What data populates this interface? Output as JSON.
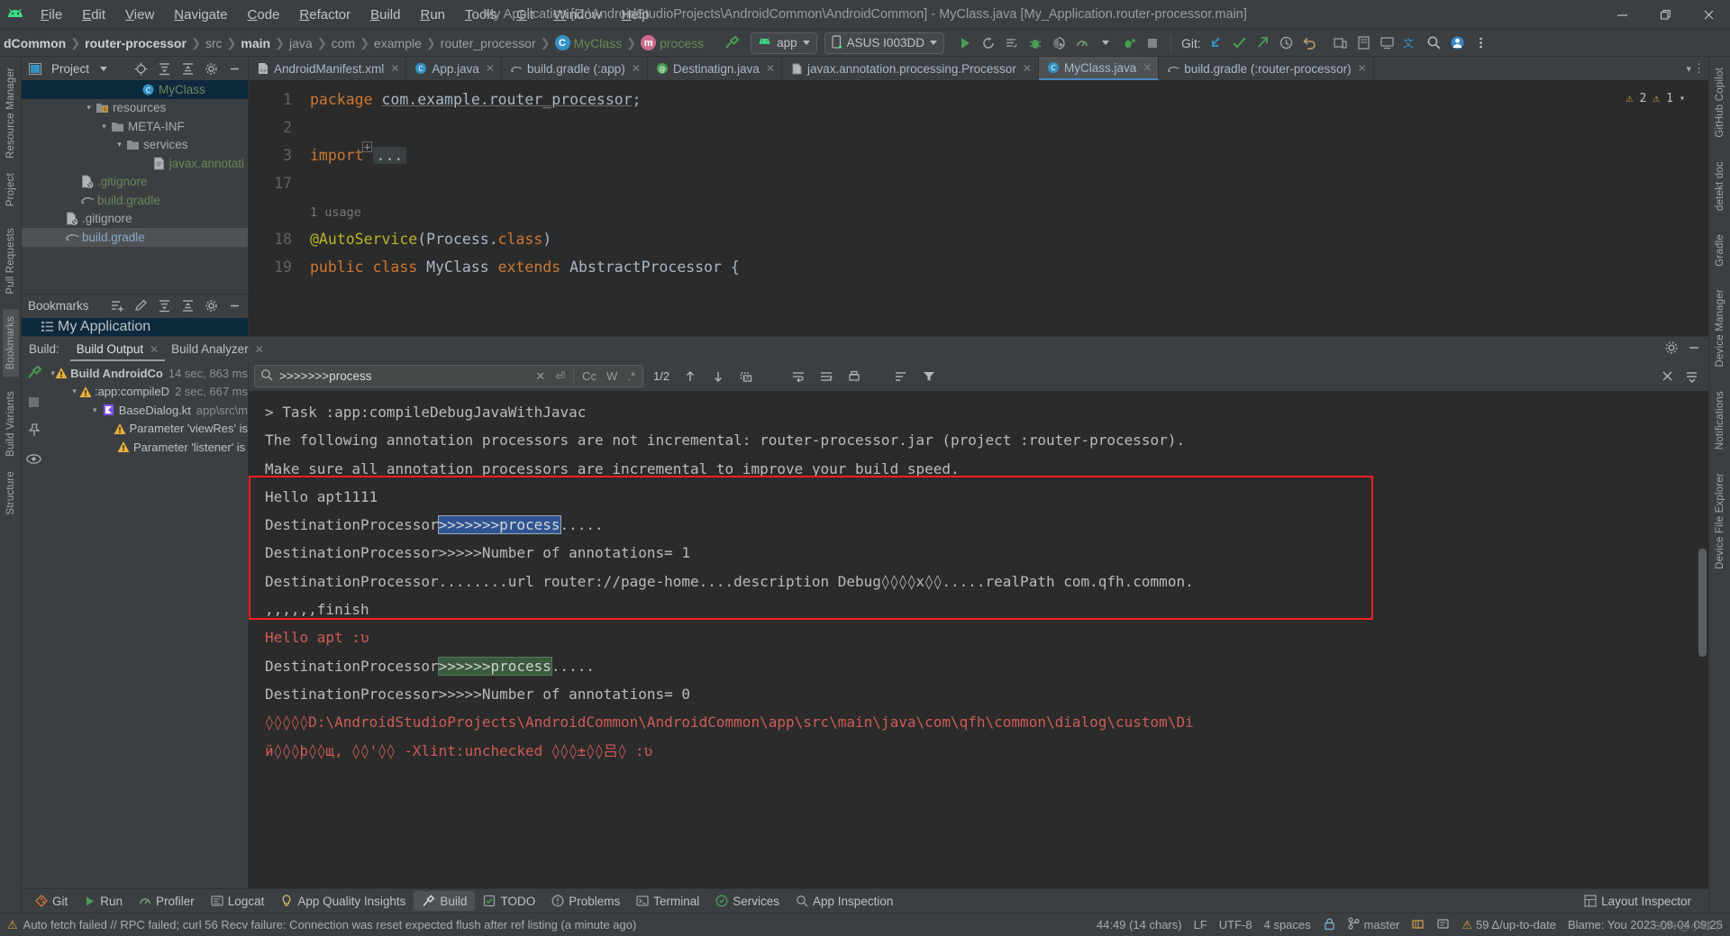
{
  "window": {
    "title": "My Application [D:\\AndroidStudioProjects\\AndroidCommon\\AndroidCommon] - MyClass.java [My_Application.router-processor.main]",
    "minimize": "—",
    "maximize": "❐",
    "close": "✕",
    "logo_icon": "android-logo"
  },
  "menu": [
    {
      "label": "File",
      "mnemonic": "F"
    },
    {
      "label": "Edit",
      "mnemonic": "E"
    },
    {
      "label": "View",
      "mnemonic": "V"
    },
    {
      "label": "Navigate",
      "mnemonic": "N"
    },
    {
      "label": "Code",
      "mnemonic": "C"
    },
    {
      "label": "Refactor",
      "mnemonic": "R"
    },
    {
      "label": "Build",
      "mnemonic": "B"
    },
    {
      "label": "Run",
      "mnemonic": "R"
    },
    {
      "label": "Tools",
      "mnemonic": "T"
    },
    {
      "label": "Git",
      "mnemonic": "G"
    },
    {
      "label": "Window",
      "mnemonic": "W"
    },
    {
      "label": "Help",
      "mnemonic": "H"
    }
  ],
  "breadcrumbs": [
    {
      "label": "dCommon",
      "style": "bold"
    },
    {
      "label": "router-processor",
      "style": "bold"
    },
    {
      "label": "src",
      "style": "dim"
    },
    {
      "label": "main",
      "style": "bold"
    },
    {
      "label": "java",
      "style": "dim"
    },
    {
      "label": "com",
      "style": "dim"
    },
    {
      "label": "example",
      "style": "dim"
    },
    {
      "label": "router_processor",
      "style": "dim"
    },
    {
      "label": "MyClass",
      "style": "class",
      "icon": "C"
    },
    {
      "label": "process",
      "style": "method",
      "icon": "m"
    }
  ],
  "toolbar": {
    "build_hammer_icon": "hammer-icon",
    "run_config": {
      "label": "app",
      "icon": "android-head-icon"
    },
    "device": {
      "label": "ASUS I003DD",
      "icon": "phone-icon"
    },
    "run_icon": "run-play-icon",
    "rerun_icon": "rerun-icon",
    "apply_changes_icon": "apply-changes-icon",
    "debug_icon": "debug-bug-icon",
    "coverage_icon": "coverage-icon",
    "profiler_icon": "profiler-icon",
    "attach_debugger_icon": "attach-debugger-icon",
    "stop_icon": "stop-square-icon",
    "git_label": "Git:",
    "git_update_icon": "update-project-icon",
    "git_commit_icon": "commit-icon",
    "git_push_icon": "push-icon",
    "history_icon": "history-icon",
    "undo_icon": "undo-icon",
    "device_manager_icon": "device-manager-icon",
    "device_explorer_icon": "device-explorer-icon",
    "avd_icon": "avd-icon",
    "translate_icon": "translate-icon",
    "search_icon": "search-everywhere-icon",
    "account_icon": "account-avatar-icon",
    "more_icon": "more-vertical-icon"
  },
  "project_panel": {
    "title": "Project",
    "dropdown_icon": "chevron-down-icon",
    "locate_icon": "locate-icon",
    "expand_icon": "expand-all-icon",
    "collapse_icon": "collapse-all-icon",
    "settings_icon": "gear-icon",
    "hide_icon": "hide-icon",
    "tree": [
      {
        "label": "MyClass",
        "indent": 7,
        "icon": "class-icon",
        "color": "green",
        "selected": true,
        "chevron": ""
      },
      {
        "label": "resources",
        "indent": 4,
        "icon": "resource-folder-icon",
        "color": "gray",
        "chevron": "v"
      },
      {
        "label": "META-INF",
        "indent": 5,
        "icon": "folder-icon",
        "color": "gray",
        "chevron": "v"
      },
      {
        "label": "services",
        "indent": 6,
        "icon": "folder-icon",
        "color": "gray",
        "chevron": "v"
      },
      {
        "label": "javax.annotati",
        "indent": 8,
        "icon": "file-icon",
        "color": "green",
        "chevron": ""
      },
      {
        "label": ".gitignore",
        "indent": 3,
        "icon": "gitignore-icon",
        "color": "green",
        "chevron": ""
      },
      {
        "label": "build.gradle",
        "indent": 3,
        "icon": "gradle-icon",
        "color": "green",
        "chevron": ""
      },
      {
        "label": ".gitignore",
        "indent": 2,
        "icon": "gitignore-icon",
        "color": "gray",
        "chevron": ""
      },
      {
        "label": "build.gradle",
        "indent": 2,
        "icon": "gradle-icon",
        "color": "blue",
        "chevron": "",
        "highlight": true
      }
    ]
  },
  "bookmarks_panel": {
    "title": "Bookmarks",
    "add_icon": "add-bookmark-icon",
    "edit_icon": "edit-pencil-icon",
    "expand_icon": "expand-all-icon",
    "collapse_icon": "collapse-all-icon",
    "settings_icon": "gear-icon",
    "hide_icon": "hide-icon",
    "items": [
      {
        "label": "My Application",
        "icon": "bookmark-list-icon",
        "selected": true
      }
    ]
  },
  "editor_tabs": [
    {
      "label": "AndroidManifest.xml",
      "icon": "xml-icon",
      "icon_color": "#d3783c",
      "active": false
    },
    {
      "label": "App.java",
      "icon": "C",
      "icon_color": "#3592c4",
      "active": false
    },
    {
      "label": "build.gradle (:app)",
      "icon": "gradle-icon",
      "icon_color": "#7a8c99",
      "active": false
    },
    {
      "label": "Destinatign.java",
      "icon": "A",
      "icon_color": "#499c54",
      "active": false
    },
    {
      "label": "javax.annotation.processing.Processor",
      "icon": "file-icon",
      "icon_color": "#9aa0a6",
      "active": false
    },
    {
      "label": "MyClass.java",
      "icon": "C",
      "icon_color": "#3592c4",
      "active": true
    },
    {
      "label": "build.gradle (:router-processor)",
      "icon": "gradle-icon",
      "icon_color": "#7a8c99",
      "active": false
    }
  ],
  "editor": {
    "inspection": {
      "warnings": "2",
      "weak_warnings": "1",
      "warn_icon": "warning-triangle-icon",
      "info_icon": "info-icon",
      "chevron": "chevron-down-icon"
    },
    "lines": [
      {
        "num": "1",
        "parts": [
          {
            "t": "package ",
            "c": "kw"
          },
          {
            "t": "com.example.router_processor",
            "c": "pkg-underline"
          },
          {
            "t": ";",
            "c": "plain"
          }
        ]
      },
      {
        "num": "2",
        "parts": []
      },
      {
        "num": "3",
        "parts": [
          {
            "t": "import ",
            "c": "kw"
          },
          {
            "t": "...",
            "c": "fold"
          }
        ],
        "foldable": true
      },
      {
        "num": "17",
        "parts": []
      },
      {
        "num": "",
        "parts": [
          {
            "t": "1 usage",
            "c": "usage"
          }
        ]
      },
      {
        "num": "18",
        "parts": [
          {
            "t": "@AutoService",
            "c": "ann"
          },
          {
            "t": "(Process.",
            "c": "plain"
          },
          {
            "t": "class",
            "c": "kw"
          },
          {
            "t": ")",
            "c": "plain"
          }
        ]
      },
      {
        "num": "19",
        "parts": [
          {
            "t": "public class ",
            "c": "kw"
          },
          {
            "t": "MyClass ",
            "c": "plain"
          },
          {
            "t": "extends ",
            "c": "kw"
          },
          {
            "t": "AbstractProcessor {",
            "c": "plain"
          }
        ]
      }
    ]
  },
  "build_window": {
    "label": "Build:",
    "tabs": [
      {
        "label": "Build Output",
        "active": true,
        "closable": true
      },
      {
        "label": "Build Analyzer",
        "active": false,
        "closable": true
      }
    ],
    "settings_icon": "gear-icon",
    "minimize_icon": "minimize-icon",
    "restart_icon": "restart-build-icon",
    "stop_icon": "stop-icon",
    "eye_icon": "eye-icon",
    "pin_icon": "pin-icon",
    "tree": [
      {
        "label": "Build AndroidCo",
        "time": "14 sec, 863 ms",
        "indent": 1,
        "icon": "warning-triangle-icon",
        "chevron": "v",
        "bold": true
      },
      {
        "label": ":app:compileD",
        "time": "2 sec, 667 ms",
        "indent": 2,
        "icon": "warning-triangle-icon",
        "chevron": "v",
        "bold": false
      },
      {
        "label": "BaseDialog.kt",
        "time": "app\\src\\m",
        "indent": 3,
        "icon": "kotlin-file-icon",
        "chevron": "v",
        "bold": false
      },
      {
        "label": "Parameter 'viewRes' is",
        "time": "",
        "indent": 4,
        "icon": "warning-triangle-icon",
        "chevron": "",
        "bold": false
      },
      {
        "label": "Parameter 'listener' is",
        "time": "",
        "indent": 4,
        "icon": "warning-triangle-icon",
        "chevron": "",
        "bold": false
      }
    ]
  },
  "find_bar": {
    "search_icon": "search-icon",
    "query": ">>>>>>>process",
    "clear_icon": "close-icon",
    "history_icon": "search-history-icon",
    "match_case": "Cc",
    "words": "W",
    "regex": ".*",
    "count": "1/2",
    "prev_icon": "arrow-up-icon",
    "next_icon": "arrow-down-icon",
    "select_all_icon": "select-all-icon",
    "soft_wrap_icon": "soft-wrap-icon",
    "scroll_end_icon": "scroll-to-end-icon",
    "print_icon": "print-icon",
    "sort_icon": "sort-icon",
    "filter_icon": "filter-icon",
    "close_icon": "close-icon"
  },
  "console": {
    "lines": [
      {
        "segments": [
          {
            "t": "> Task :app:compileDebugJavaWithJavac",
            "style": "plain"
          }
        ]
      },
      {
        "segments": [
          {
            "t": "The following annotation processors are not incremental: router-processor.jar (project :router-processor).",
            "style": "plain"
          }
        ]
      },
      {
        "segments": [
          {
            "t": "Make sure all annotation processors are incremental to improve your build speed.",
            "style": "plain"
          }
        ]
      },
      {
        "segments": [
          {
            "t": "Hello apt1111",
            "style": "plain"
          }
        ]
      },
      {
        "segments": [
          {
            "t": "DestinationProcessor",
            "style": "plain"
          },
          {
            "t": ">>>>>>>process",
            "style": "sel-blue"
          },
          {
            "t": ".....",
            "style": "plain"
          }
        ]
      },
      {
        "segments": [
          {
            "t": "DestinationProcessor>>>>>Number of annotations= 1",
            "style": "plain"
          }
        ]
      },
      {
        "segments": [
          {
            "t": "DestinationProcessor........url router://page-home....description Debug◊◊◊◊x◊◊.....realPath com.qfh.common.",
            "style": "plain"
          }
        ]
      },
      {
        "segments": [
          {
            "t": ",,,,,,finish",
            "style": "plain"
          }
        ]
      },
      {
        "segments": [
          {
            "t": "Hello apt :ʋ",
            "style": "err"
          }
        ]
      },
      {
        "segments": [
          {
            "t": "DestinationProcessor",
            "style": "plain"
          },
          {
            "t": ">>>>>>process",
            "style": "sel-green"
          },
          {
            "t": ".....",
            "style": "plain"
          }
        ]
      },
      {
        "segments": [
          {
            "t": "DestinationProcessor>>>>>Number of annotations= 0",
            "style": "plain"
          }
        ]
      },
      {
        "segments": [
          {
            "t": "◊◊◊◊◊D:\\AndroidStudioProjects\\AndroidCommon\\AndroidCommon\\app\\src\\main\\java\\com\\qfh\\common\\dialog\\custom\\Di",
            "style": "err"
          }
        ]
      },
      {
        "segments": [
          {
            "t": "й◊◊◊þ◊◊щ, ◊◊'◊◊ -Xlint:unchecked ◊◊◊±◊◊吕◊ :ʋ",
            "style": "err"
          }
        ]
      }
    ],
    "highlight_box_color": "#ff1f1f"
  },
  "bottom_bar": {
    "items": [
      {
        "label": "Git",
        "icon": "git-icon",
        "active": false
      },
      {
        "label": "Run",
        "icon": "run-play-icon",
        "active": false
      },
      {
        "label": "Profiler",
        "icon": "profiler-icon",
        "active": false
      },
      {
        "label": "Logcat",
        "icon": "logcat-icon",
        "active": false
      },
      {
        "label": "App Quality Insights",
        "icon": "insights-icon",
        "active": false
      },
      {
        "label": "Build",
        "icon": "hammer-icon",
        "active": true
      },
      {
        "label": "TODO",
        "icon": "todo-icon",
        "active": false
      },
      {
        "label": "Problems",
        "icon": "problems-icon",
        "active": false
      },
      {
        "label": "Terminal",
        "icon": "terminal-icon",
        "active": false
      },
      {
        "label": "Services",
        "icon": "services-icon",
        "active": false
      },
      {
        "label": "App Inspection",
        "icon": "app-inspection-icon",
        "active": false
      }
    ],
    "right": {
      "label": "Layout Inspector",
      "icon": "layout-inspector-icon"
    }
  },
  "left_rail": {
    "tabs": [
      {
        "label": "Resource Manager"
      },
      {
        "label": "Project"
      },
      {
        "label": "Pull Requests"
      },
      {
        "label": "Bookmarks"
      },
      {
        "label": "Build Variants"
      },
      {
        "label": "Structure"
      }
    ],
    "icons": [
      "commit-icon",
      "debug-icon",
      "pin-icon",
      "eye-icon"
    ]
  },
  "right_rail": {
    "tabs": [
      {
        "label": "GitHub Copilot"
      },
      {
        "label": "detekt doc"
      },
      {
        "label": "Gradle"
      },
      {
        "label": "Device Manager"
      },
      {
        "label": "Notifications"
      },
      {
        "label": "Device File Explorer"
      }
    ]
  },
  "status_bar": {
    "message": "Auto fetch failed // RPC failed; curl 56 Recv failure: Connection was reset expected flush after ref listing (a minute ago)",
    "position": "44:49 (14 chars)",
    "line_sep": "LF",
    "encoding": "UTF-8",
    "indent": "4 spaces",
    "lock_icon": "read-only-icon",
    "branch_icon": "branch-icon",
    "branch": "master",
    "inspection_icon": "inspection-icon",
    "memory_icon": "memory-icon",
    "warn_count": "59 Δ/up-to-date",
    "blame": "Blame: You 2023-09-04 09:25",
    "watermark": "CSDN @小峰下"
  }
}
